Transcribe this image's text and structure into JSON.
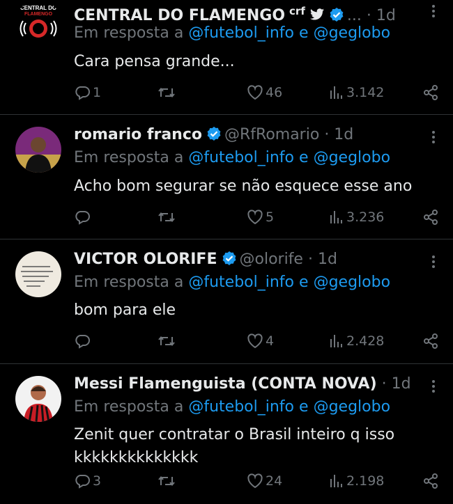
{
  "tweets": [
    {
      "name": "CENTRAL DO FLAMENGO",
      "name_suffix": "crf",
      "handle": "...",
      "time": "· 1d",
      "reply_prefix": "Em resposta a",
      "mention1": "@futebol_info",
      "conj": "e",
      "mention2": "@geglobo",
      "text": "Cara pensa grande...",
      "replies": "1",
      "retweets": "",
      "likes": "46",
      "views": "3.142",
      "avatar_text_top": "CENTRAL DO",
      "avatar_text_bottom": "FLAMENGO"
    },
    {
      "name": "romario franco",
      "handle": "@RfRomario",
      "time": "· 1d",
      "reply_prefix": "Em resposta a",
      "mention1": "@futebol_info",
      "conj": "e",
      "mention2": "@geglobo",
      "text": "Acho bom segurar se não esquece esse ano",
      "replies": "",
      "retweets": "",
      "likes": "5",
      "views": "3.236"
    },
    {
      "name": "VICTOR OLORIFE",
      "handle": "@olorife",
      "time": "· 1d",
      "reply_prefix": "Em resposta a",
      "mention1": "@futebol_info",
      "conj": "e",
      "mention2": "@geglobo",
      "text": "bom para ele",
      "replies": "",
      "retweets": "",
      "likes": "4",
      "views": "2.428"
    },
    {
      "name": "Messi Flamenguista (CONTA NOVA)",
      "handle": "",
      "time": "· 1d",
      "reply_prefix": "Em resposta a",
      "mention1": "@futebol_info",
      "conj": "e",
      "mention2": "@geglobo",
      "text": "Zenit quer contratar o Brasil inteiro q isso kkkkkkkkkkkkkk",
      "replies": "3",
      "retweets": "",
      "likes": "24",
      "views": "2.198"
    }
  ],
  "colors": {
    "accent": "#1d9bf0",
    "muted": "#71767b",
    "text": "#e7e9ea",
    "bg": "#000000",
    "divider": "#2f3336"
  },
  "icons": [
    "reply-icon",
    "retweet-icon",
    "like-icon",
    "views-icon",
    "share-icon",
    "verified-badge-icon",
    "twitter-bird-icon",
    "more-options-icon"
  ]
}
